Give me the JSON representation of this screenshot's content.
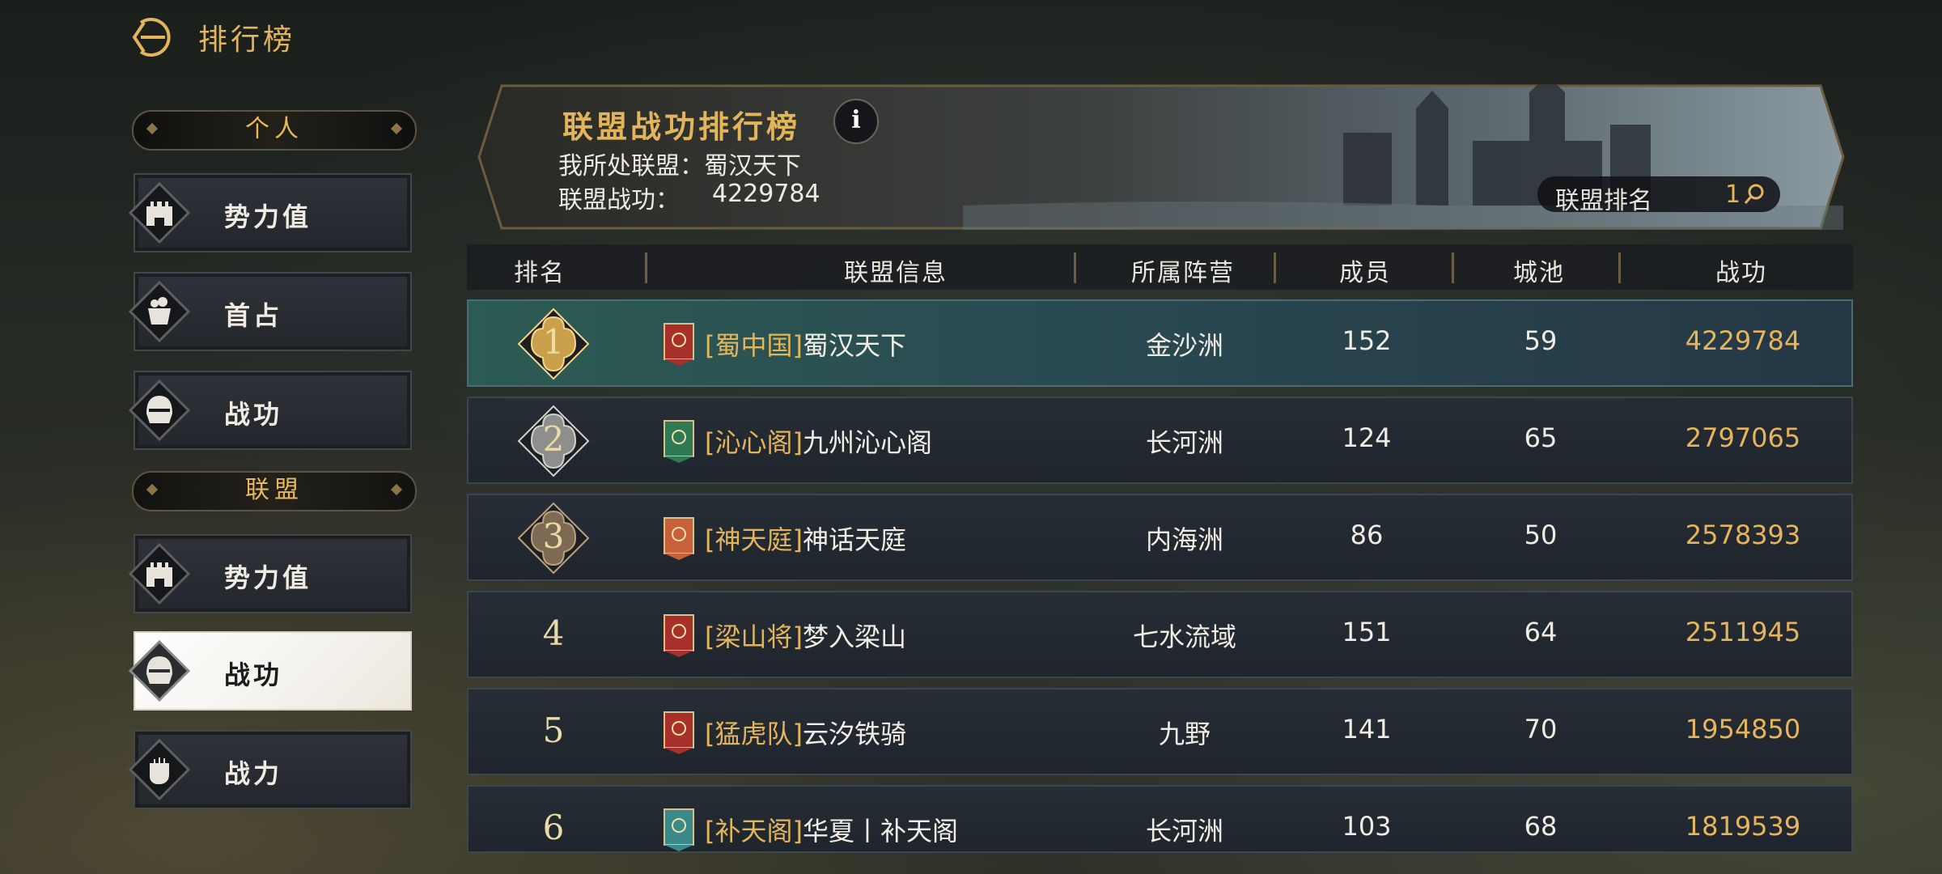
{
  "header": {
    "title": "排行榜"
  },
  "sidebar": {
    "personal_label": "个人",
    "alliance_label": "联盟",
    "personal_items": [
      {
        "label": "势力值",
        "icon": "castle-icon"
      },
      {
        "label": "首占",
        "icon": "treasure-icon"
      },
      {
        "label": "战功",
        "icon": "helmet-icon"
      }
    ],
    "alliance_items": [
      {
        "label": "势力值",
        "icon": "castle-icon"
      },
      {
        "label": "战功",
        "icon": "helmet-icon",
        "active": true
      },
      {
        "label": "战力",
        "icon": "fist-icon"
      }
    ]
  },
  "banner": {
    "title": "联盟战功排行榜",
    "info": "i",
    "my_alliance_label": "我所处联盟：",
    "my_alliance_value": "蜀汉天下",
    "alliance_power_label": "联盟战功：",
    "alliance_power_value": "4229784",
    "rank_search_label": "联盟排名",
    "rank_search_value": "1"
  },
  "table": {
    "headers": [
      "排名",
      "联盟信息",
      "所属阵营",
      "成员",
      "城池",
      "战功"
    ],
    "rows": [
      {
        "rank": "1",
        "tag": "[蜀中国]",
        "name": "蜀汉天下",
        "camp": "金沙洲",
        "members": "152",
        "cities": "59",
        "power": "4229784",
        "flag_color": "#a8302a"
      },
      {
        "rank": "2",
        "tag": "[沁心阁]",
        "name": "九州沁心阁",
        "camp": "长河洲",
        "members": "124",
        "cities": "65",
        "power": "2797065",
        "flag_color": "#2f7a55"
      },
      {
        "rank": "3",
        "tag": "[神天庭]",
        "name": "神话天庭",
        "camp": "内海洲",
        "members": "86",
        "cities": "50",
        "power": "2578393",
        "flag_color": "#c8603a"
      },
      {
        "rank": "4",
        "tag": "[梁山将]",
        "name": "梦入梁山",
        "camp": "七水流域",
        "members": "151",
        "cities": "64",
        "power": "2511945",
        "flag_color": "#a8302a"
      },
      {
        "rank": "5",
        "tag": "[猛虎队]",
        "name": "云汐铁骑",
        "camp": "九野",
        "members": "141",
        "cities": "70",
        "power": "1954850",
        "flag_color": "#a8302a"
      },
      {
        "rank": "6",
        "tag": "[补天阁]",
        "name": "华夏丨补天阁",
        "camp": "长河洲",
        "members": "103",
        "cities": "68",
        "power": "1819539",
        "flag_color": "#3a8a8a"
      }
    ]
  },
  "colors": {
    "gold": "#e2b45c",
    "panel": "#23282e",
    "first_row": "#2b5b52"
  }
}
